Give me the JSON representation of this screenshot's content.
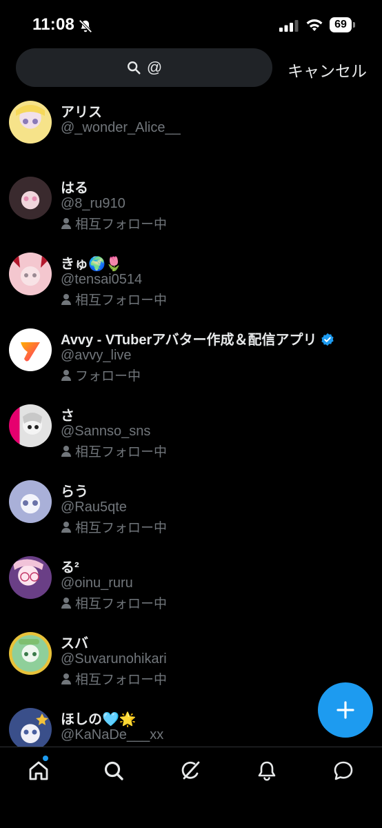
{
  "status_bar": {
    "time": "11:08",
    "battery": "69"
  },
  "search": {
    "query": "@",
    "cancel_label": "キャンセル"
  },
  "users": [
    {
      "name": "アリス",
      "handle": "@_wonder_Alice__",
      "follow_status": "",
      "avatar_colors": [
        "#f6e38a",
        "#c9b2e0"
      ]
    },
    {
      "name": "はる",
      "handle": "@8_ru910",
      "follow_status": "相互フォロー中",
      "avatar_colors": [
        "#3a2a2e",
        "#e48fb2"
      ]
    },
    {
      "name": "きゅ🌍🌷",
      "handle": "@tensai0514",
      "follow_status": "相互フォロー中",
      "avatar_colors": [
        "#f4c7cf",
        "#b3172c"
      ]
    },
    {
      "name": "Avvy - VTuberアバター作成＆配信アプリ",
      "handle": "@avvy_live",
      "follow_status": "フォロー中",
      "verified": true,
      "avatar_colors": [
        "#ffffff",
        "#ff4d4d"
      ]
    },
    {
      "name": "さ",
      "handle": "@Sannso_sns",
      "follow_status": "相互フォロー中",
      "avatar_colors": [
        "#e2e2e2",
        "#e6006e"
      ]
    },
    {
      "name": "らう",
      "handle": "@Rau5qte",
      "follow_status": "相互フォロー中",
      "avatar_colors": [
        "#dfe3f5",
        "#8a93c9"
      ]
    },
    {
      "name": "る²",
      "handle": "@oinu_ruru",
      "follow_status": "相互フォロー中",
      "avatar_colors": [
        "#f1c3d9",
        "#6a3f86"
      ]
    },
    {
      "name": "スバ",
      "handle": "@Suvarunohikari",
      "follow_status": "相互フォロー中",
      "avatar_colors": [
        "#bfe3c2",
        "#e8c23a"
      ]
    },
    {
      "name": "ほしの🩵🌟",
      "handle": "@KaNaDe___xx",
      "follow_status": "",
      "avatar_colors": [
        "#c7d6f0",
        "#3a4f8a"
      ]
    }
  ],
  "tabs": [
    "home-icon",
    "search-icon",
    "grok-icon",
    "bell-icon",
    "messages-icon"
  ],
  "colors": {
    "accent": "#1d9bf0",
    "background": "#000000",
    "secondary_text": "#71767b"
  }
}
